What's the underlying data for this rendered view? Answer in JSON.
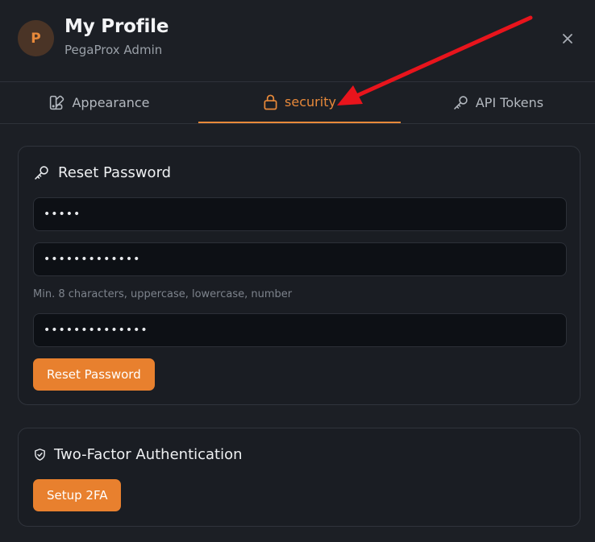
{
  "header": {
    "avatar_initial": "P",
    "title": "My Profile",
    "subtitle": "PegaProx Admin",
    "close_icon": "×"
  },
  "tabs": [
    {
      "label": "Appearance",
      "icon": "palette-icon",
      "active": false
    },
    {
      "label": "security",
      "icon": "lock-icon",
      "active": true
    },
    {
      "label": "API Tokens",
      "icon": "key-icon",
      "active": false
    }
  ],
  "reset_password": {
    "title": "Reset Password",
    "current_password_value": "•••••",
    "new_password_value": "•••••••••••••",
    "hint": "Min. 8 characters, uppercase, lowercase, number",
    "confirm_password_value": "••••••••••••••",
    "button_label": "Reset Password"
  },
  "two_factor": {
    "title": "Two-Factor Authentication",
    "button_label": "Setup 2FA"
  },
  "colors": {
    "accent": "#e8802e",
    "annotation_arrow": "#e8141c",
    "background": "#1c1f25"
  }
}
